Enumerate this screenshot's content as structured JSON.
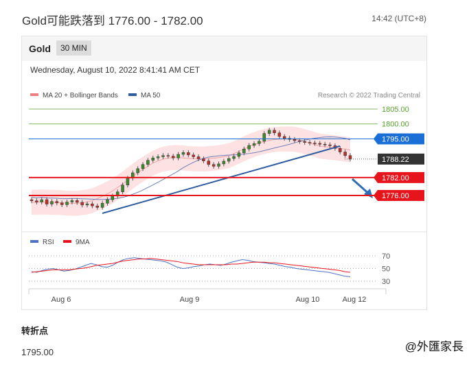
{
  "header": {
    "headline": "Gold可能跌落到 1776.00 - 1782.00",
    "time": "14:42 (UTC+8)"
  },
  "panel": {
    "symbol": "Gold",
    "timeframe": "30 MIN",
    "datetime": "Wednesday, August 10, 2022 8:41:41 AM CET"
  },
  "chart_data": {
    "type": "candlestick",
    "legend": [
      {
        "name": "MA 20 + Bollinger Bands",
        "color": "#f08080"
      },
      {
        "name": "MA 50",
        "color": "#2e5c9e"
      }
    ],
    "credit": "Research © 2022 Trading Central",
    "x_ticks": [
      "Aug 6",
      "Aug 9",
      "Aug 10",
      "Aug 12"
    ],
    "price_levels": [
      {
        "label": "1805.00",
        "value": 1805.0,
        "kind": "target",
        "color": "#5aa02c"
      },
      {
        "label": "1800.00",
        "value": 1800.0,
        "kind": "target",
        "color": "#5aa02c"
      },
      {
        "label": "1795.00",
        "value": 1795.0,
        "kind": "pivot",
        "color": "#1a6fd6"
      },
      {
        "label": "1788.22",
        "value": 1788.22,
        "kind": "last",
        "color": "#333333"
      },
      {
        "label": "1782.00",
        "value": 1782.0,
        "kind": "support",
        "color": "#e8141c"
      },
      {
        "label": "1776.00",
        "value": 1776.0,
        "kind": "support",
        "color": "#e8141c"
      }
    ],
    "price_series": [
      1774.2,
      1773.8,
      1774.6,
      1773.1,
      1774.0,
      1773.5,
      1772.9,
      1773.8,
      1774.3,
      1773.7,
      1772.8,
      1773.2,
      1772.5,
      1772.0,
      1773.4,
      1774.6,
      1775.8,
      1777.2,
      1779.5,
      1781.8,
      1783.6,
      1785.0,
      1786.4,
      1787.8,
      1788.6,
      1789.0,
      1789.4,
      1789.2,
      1788.6,
      1789.8,
      1790.4,
      1789.6,
      1789.0,
      1788.3,
      1787.6,
      1786.4,
      1785.8,
      1786.6,
      1787.5,
      1788.4,
      1789.1,
      1790.3,
      1791.6,
      1792.8,
      1793.4,
      1794.2,
      1796.8,
      1797.9,
      1797.0,
      1795.8,
      1795.2,
      1794.8,
      1794.4,
      1794.1,
      1793.8,
      1793.6,
      1793.5,
      1793.2,
      1793.0,
      1792.7,
      1791.8,
      1790.6,
      1789.4,
      1788.22
    ],
    "rsi_series": [
      45,
      44,
      47,
      49,
      50,
      48,
      46,
      47,
      49,
      52,
      55,
      58,
      56,
      53,
      52,
      55,
      60,
      64,
      66,
      67,
      66,
      65,
      64,
      63,
      62,
      60,
      56,
      52,
      50,
      51,
      53,
      54,
      56,
      57,
      56,
      55,
      57,
      60,
      62,
      64,
      63,
      61,
      60,
      59,
      58,
      57,
      55,
      53,
      52,
      50,
      49,
      48,
      47,
      46,
      45,
      44,
      42,
      40,
      38,
      37
    ],
    "rsi_ma_series": [
      44,
      45,
      46,
      47,
      48,
      48,
      48,
      48,
      49,
      50,
      51,
      53,
      55,
      56,
      57,
      58,
      60,
      62,
      63,
      64,
      65,
      65,
      66,
      65,
      64,
      63,
      62,
      61,
      59,
      58,
      57,
      56,
      56,
      56,
      56,
      56,
      56,
      57,
      57,
      58,
      59,
      60,
      60,
      60,
      59,
      59,
      58,
      57,
      56,
      55,
      54,
      53,
      52,
      51,
      50,
      49,
      48,
      47,
      45,
      44
    ],
    "rsi_ticks": [
      70,
      50,
      30
    ],
    "rsi_legend": [
      {
        "name": "RSI",
        "color": "#4a72c4"
      },
      {
        "name": "9MA",
        "color": "#e8141c"
      }
    ]
  },
  "section_title": "转折点",
  "pivot_value": "1795.00",
  "watermark": "@外匯家長"
}
